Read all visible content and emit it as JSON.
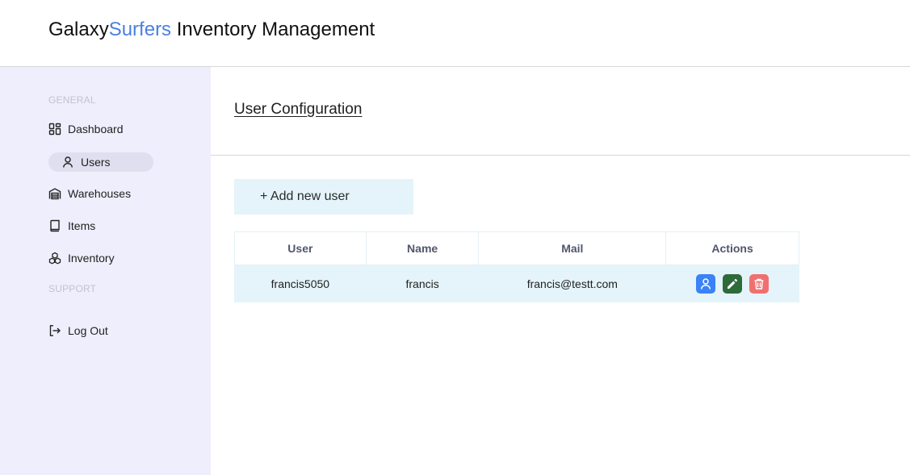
{
  "header": {
    "brand_part1": "Galaxy",
    "brand_part2": "Surfers",
    "brand_part3": " Inventory Management",
    "accent_color": "#4a80e0"
  },
  "sidebar": {
    "section_general": "GENERAL",
    "section_support": "SUPPORT",
    "items": [
      {
        "label": "Dashboard",
        "icon": "dashboard-icon"
      },
      {
        "label": "Users",
        "icon": "user-icon",
        "active": true
      },
      {
        "label": "Warehouses",
        "icon": "warehouse-icon"
      },
      {
        "label": "Items",
        "icon": "book-icon"
      },
      {
        "label": "Inventory",
        "icon": "boxes-icon"
      }
    ],
    "logout": {
      "label": "Log Out",
      "icon": "logout-icon"
    }
  },
  "main": {
    "title": "User Configuration",
    "add_button_label": "+ Add new user",
    "table": {
      "headers": [
        "User",
        "Name",
        "Mail",
        "Actions"
      ],
      "rows": [
        {
          "user": "francis5050",
          "name": "francis",
          "mail": "francis@testt.com"
        }
      ],
      "actions": [
        {
          "icon": "user-profile-icon",
          "color": "#3b82f6"
        },
        {
          "icon": "edit-pencil-icon",
          "color": "#2e6b3a"
        },
        {
          "icon": "trash-icon",
          "color": "#f07070"
        }
      ]
    }
  }
}
